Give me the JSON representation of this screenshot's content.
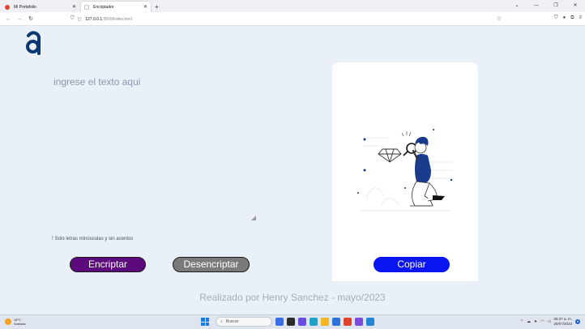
{
  "browser": {
    "tabs": [
      {
        "label": "Mi Portafolio",
        "active": false
      },
      {
        "label": "Encriptador",
        "active": true
      }
    ],
    "new_tab": "+",
    "address": {
      "host": "127.0.0.1",
      "path": ":5500/index.html"
    }
  },
  "page": {
    "input_placeholder": "ingrese el texto aqui",
    "hint_icon": "!",
    "hint": "Solo letras minúsculas y sin acentos",
    "encrypt_label": "Encriptar",
    "decrypt_label": "Desencriptar",
    "copy_label": "Copiar",
    "footer": "Realizado por Henry Sanchez - mayo/2023",
    "colors": {
      "encrypt": "#5d0a7c",
      "decrypt": "#7a7a7a",
      "copy": "#0a15ef",
      "logo": "#0a3871"
    }
  },
  "taskbar": {
    "weather_temp": "18°C",
    "weather_desc": "Soleado",
    "search_label": "Buscar",
    "time": "08:37 a. m.",
    "date": "29/07/2023"
  }
}
